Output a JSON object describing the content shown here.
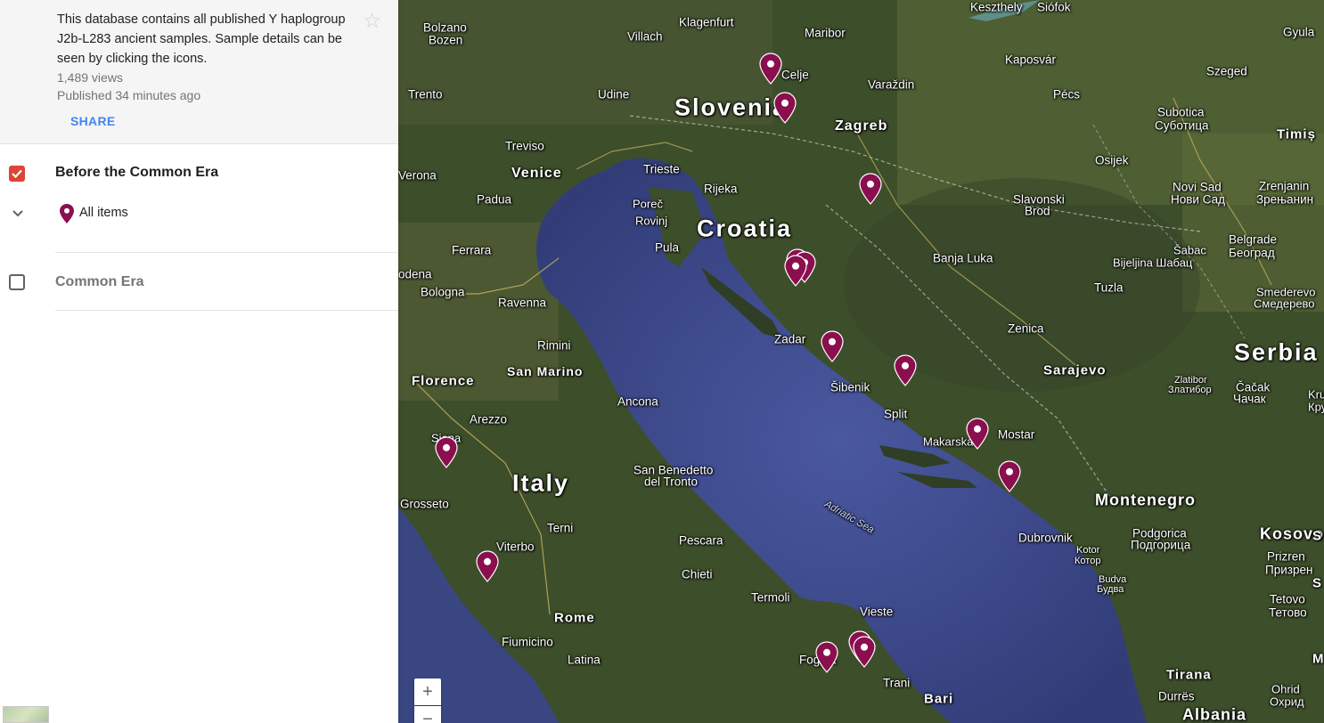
{
  "sidebar": {
    "description": "This database contains all published Y haplogroup J2b-L283 ancient samples. Sample details can be seen by clicking the icons.",
    "views": "1,489 views",
    "published": "Published 34 minutes ago",
    "share_label": "SHARE",
    "layers": [
      {
        "title": "Before the Common Era",
        "checked": true,
        "items_label": "All items"
      },
      {
        "title": "Common Era",
        "checked": false
      }
    ]
  },
  "map": {
    "marker_color": "#8b0e4f",
    "zoom_in": "+",
    "zoom_out": "−",
    "labels": {
      "slovenia": "Slovenia",
      "croatia": "Croatia",
      "italy": "Italy",
      "serbia": "Serbia",
      "montenegro": "Montenegro",
      "kosovo": "Kosovo",
      "albania": "Albania",
      "adriatic": "Adriatic Sea",
      "bolzano": "Bolzano",
      "bozen": "Bozen",
      "klagenfurt": "Klagenfurt",
      "villach": "Villach",
      "maribor": "Maribor",
      "celje": "Celje",
      "keszthely": "Keszthely",
      "siofok": "Siófok",
      "kaposvar": "Kaposvár",
      "gyula": "Gyula",
      "szeged": "Szeged",
      "varazdin": "Varaždin",
      "pecs": "Pécs",
      "trento": "Trento",
      "udine": "Udine",
      "zagreb": "Zagreb",
      "subotica": "Subotica",
      "subotica_cyr": "Суботица",
      "timis": "Timiș",
      "treviso": "Treviso",
      "venice": "Venice",
      "trieste": "Trieste",
      "osijek": "Osijek",
      "verona": "Verona",
      "padua": "Padua",
      "porec": "Poreč",
      "rovinj": "Rovinj",
      "rijeka": "Rijeka",
      "slavonski": "Slavonski",
      "brod": "Brod",
      "novisad": "Novi Sad",
      "novisad_cyr": "Нови Сад",
      "zrenjanin": "Zrenjanin",
      "zrenjanin_cyr": "Зрењанин",
      "pula": "Pula",
      "sabac": "Šabac",
      "bijeljina": "Bijeljina Шабац",
      "belgrade": "Belgrade",
      "beograd": "Београд",
      "ferrara": "Ferrara",
      "banjaluka": "Banja Luka",
      "modena": "odena",
      "bologna": "Bologna",
      "tuzla": "Tuzla",
      "smederevo": "Smederevo",
      "smederevo_cyr": "Смедерево",
      "ravenna": "Ravenna",
      "zenica": "Zenica",
      "zadar": "Zadar",
      "rimini": "Rimini",
      "sanmarino": "San Marino",
      "sarajevo": "Sarajevo",
      "florence": "Florence",
      "sibenik": "Šibenik",
      "zlatibor": "Zlatibor",
      "zlatibor_cyr": "Златибор",
      "cacak": "Čačak",
      "cacak_cyr": "Чачак",
      "kru": "Kru",
      "kru_cyr": "Кру",
      "ancona": "Ancona",
      "split": "Split",
      "arezzo": "Arezzo",
      "siena": "Siena",
      "makarska": "Makarska",
      "mostar": "Mostar",
      "sanbenedetto": "San Benedetto",
      "deltronto": "del Tronto",
      "grosseto": "Grosseto",
      "terni": "Terni",
      "dubrovnik": "Dubrovnik",
      "kotor": "Kotor",
      "kotor_cyr": "Котор",
      "podgorica": "Podgorica",
      "podgorica_cyr": "Подгорица",
      "pescara": "Pescara",
      "prizren": "Prizren",
      "prizren_cyr": "Призрен",
      "viterbo": "Viterbo",
      "chieti": "Chieti",
      "budva": "Budva",
      "budva_cyr": "Будва",
      "tetovo": "Tetovo",
      "tetovo_cyr": "Тетово",
      "termoli": "Termoli",
      "rome": "Rome",
      "vieste": "Vieste",
      "fiumicino": "Fiumicino",
      "latina": "Latina",
      "foggia": "Foggia",
      "tirana": "Tirana",
      "trani": "Trani",
      "bari": "Bari",
      "durres": "Durrës",
      "ohrid": "Ohrid",
      "ohrid_cyr": "Охрид",
      "s1": "S",
      "m1": "M",
      "s2": "S"
    }
  }
}
